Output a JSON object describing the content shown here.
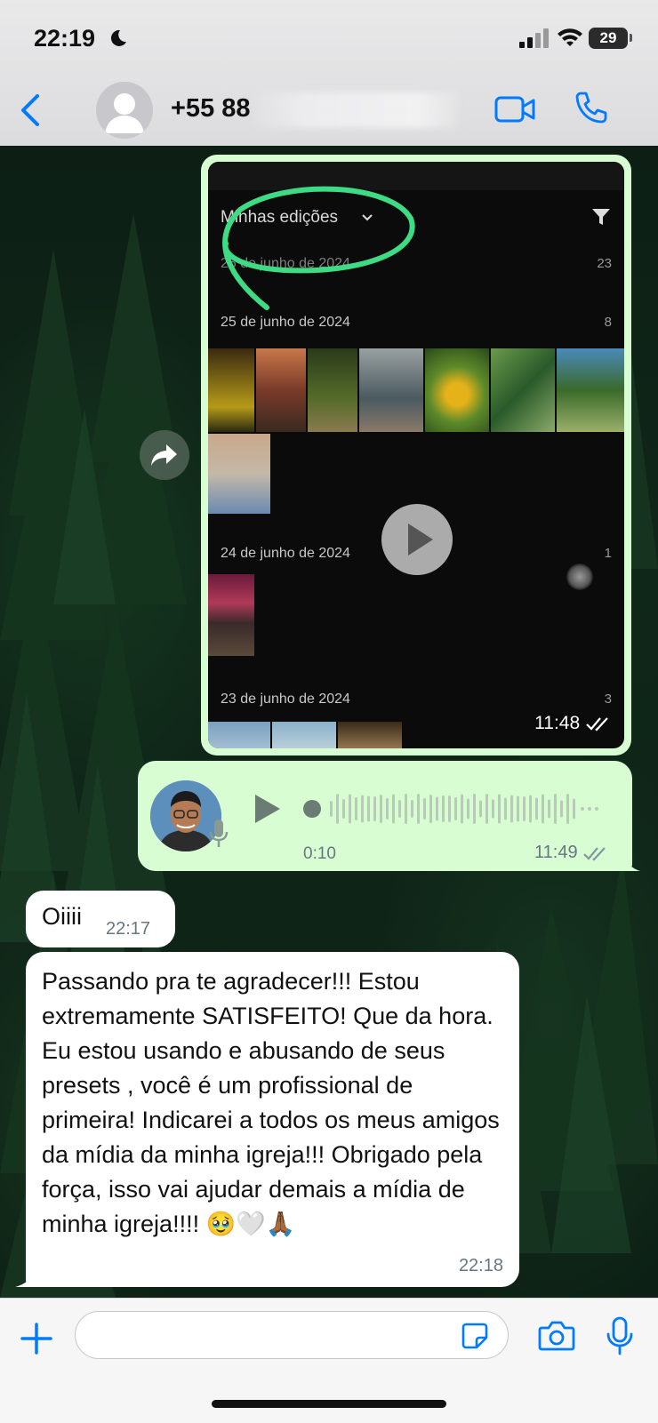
{
  "status_bar": {
    "time": "22:19",
    "battery": "29"
  },
  "header": {
    "contact_name": "+55 88 ",
    "back_label": "back"
  },
  "image_message": {
    "screenshot": {
      "title": "Minhas edições",
      "sections": [
        {
          "date": "26 de junho de 2024",
          "count": "23"
        },
        {
          "date": "25 de junho de 2024",
          "count": "8"
        },
        {
          "date": "24 de junho de 2024",
          "count": "1"
        },
        {
          "date": "23 de junho de 2024",
          "count": "3"
        }
      ]
    },
    "time": "11:48"
  },
  "voice_message": {
    "duration": "0:10",
    "time": "11:49"
  },
  "incoming": [
    {
      "text": "Oiiii",
      "time": "22:17"
    },
    {
      "text": "Passando pra te agradecer!!! Estou extremamente SATISFEITO! Que da hora. Eu estou usando e abusando de seus presets , você é um profissional de primeira! Indicarei a todos os meus amigos da mídia da minha igreja!!! Obrigado pela força, isso vai ajudar demais a mídia de minha igreja!!!! 🥹🤍🙏🏾",
      "time": "22:18"
    }
  ],
  "colors": {
    "accent": "#007aff",
    "outgoing_bubble": "#d9fdd3",
    "incoming_bubble": "#ffffff",
    "meta_text": "#667781"
  }
}
